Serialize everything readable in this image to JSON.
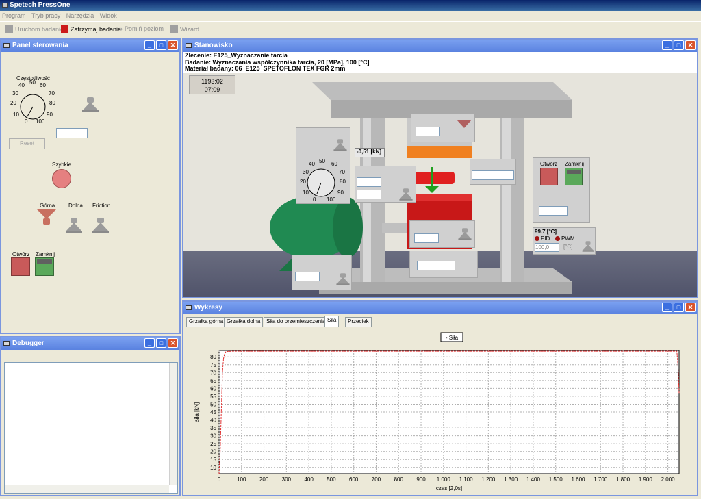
{
  "app": {
    "title": "Spetech PressOne"
  },
  "menu": [
    "Program",
    "Tryb pracy",
    "Narzędzia",
    "Widok"
  ],
  "toolbar": {
    "run_label": "Uruchom badanie",
    "stop_label": "Zatrzymaj badanie",
    "skip_label": "Pomiń poziom",
    "wizard_label": "Wizard"
  },
  "colors": {
    "accent": "#0a246a",
    "stop_red": "#cc1a1a",
    "chart_line": "#e03030"
  },
  "panel": {
    "title": "Panel sterowania",
    "dial_label": "Częstotliwość",
    "dial_ticks": [
      "0",
      "10",
      "20",
      "30",
      "40",
      "50",
      "60",
      "70",
      "80",
      "90",
      "100"
    ],
    "reset_label": "Reset",
    "fast_label": "Szybkie",
    "upper_label": "Górna",
    "lower_label": "Dolna",
    "friction_label": "Friction",
    "open_label": "Otwórz",
    "close_label": "Zamknij",
    "freq_value": ""
  },
  "debugger": {
    "title": "Debugger"
  },
  "stanowisko": {
    "title": "Stanowisko",
    "line1": "Zlecenie: E125_Wyznaczanie tarcia",
    "line2": "Badanie: Wyznaczania współczynnika tarcia, 20 [MPa], 100 [°C]",
    "line3": "Materiał badany: 06_E125_SPETOFLON TEX FGR 2mm",
    "time1": "1193:02",
    "time2": "07:09",
    "force_readout": "-0,51 [kN]",
    "open_label": "Otwórz",
    "close_label": "Zamknij",
    "temp": "99.7 [°C]",
    "pid_label": "PID",
    "pwm_label": "PWM",
    "setpoint": "100,0",
    "unit": "[°C]",
    "dial_ticks": [
      "0",
      "10",
      "20",
      "30",
      "40",
      "50",
      "60",
      "70",
      "80",
      "90",
      "100"
    ]
  },
  "wykresy": {
    "title": "Wykresy",
    "tabs": [
      "Grzałka górna",
      "Grzałka dolna",
      "Siła do przemieszczenia",
      "Siła",
      "Przeciek"
    ],
    "active_tab": 3
  },
  "chart_data": {
    "type": "line",
    "legend": [
      "Siła"
    ],
    "xlabel": "czas [2,0s]",
    "ylabel": "siła [kN]",
    "xlim": [
      0,
      2050
    ],
    "ylim": [
      6,
      84
    ],
    "xticks": [
      0,
      100,
      200,
      300,
      400,
      500,
      600,
      700,
      800,
      900,
      1000,
      1100,
      1200,
      1300,
      1400,
      1500,
      1600,
      1700,
      1800,
      1900,
      2000
    ],
    "xtick_labels": [
      "0",
      "100",
      "200",
      "300",
      "400",
      "500",
      "600",
      "700",
      "800",
      "900",
      "1 000",
      "1 100",
      "1 200",
      "1 300",
      "1 400",
      "1 500",
      "1 600",
      "1 700",
      "1 800",
      "1 900",
      "2 000"
    ],
    "yticks": [
      10,
      15,
      20,
      25,
      30,
      35,
      40,
      45,
      50,
      55,
      60,
      65,
      70,
      75,
      80
    ],
    "series": [
      {
        "name": "Siła",
        "x": [
          0,
          5,
          10,
          15,
          20,
          25,
          30,
          40,
          60,
          100,
          500,
          1000,
          1500,
          1900,
          2000,
          2040,
          2045,
          2050
        ],
        "y": [
          6,
          20,
          45,
          70,
          79,
          82,
          83.2,
          83.4,
          83.5,
          83.5,
          83.5,
          83.5,
          83.5,
          83.5,
          83.5,
          83.5,
          75,
          57
        ]
      }
    ],
    "grid": true,
    "legend_placement": "top-center"
  }
}
